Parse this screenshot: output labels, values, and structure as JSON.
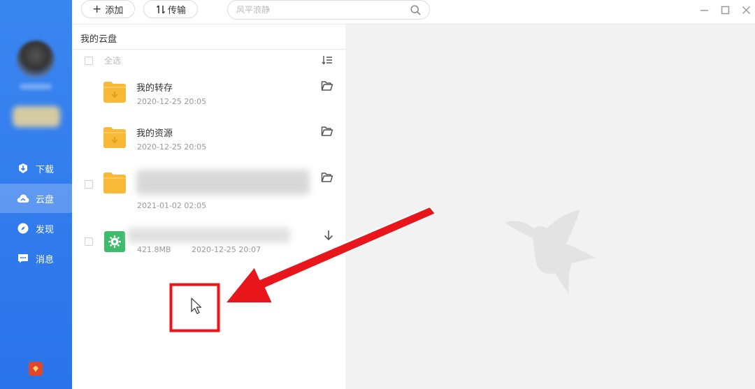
{
  "sidebar": {
    "items": [
      {
        "label": "下载",
        "icon": "download-icon"
      },
      {
        "label": "云盘",
        "icon": "cloud-icon"
      },
      {
        "label": "发现",
        "icon": "compass-icon"
      },
      {
        "label": "消息",
        "icon": "message-icon"
      }
    ],
    "active": "云盘"
  },
  "toolbar": {
    "add_label": "添加",
    "transfer_label": "传输",
    "search_placeholder": "风平浪静"
  },
  "panel": {
    "breadcrumb": "我的云盘",
    "select_all": "全选",
    "files": [
      {
        "name": "我的转存",
        "date": "2020-12-25 20:05",
        "type": "folder"
      },
      {
        "name": "我的资源",
        "date": "2020-12-25 20:05",
        "type": "folder"
      },
      {
        "name": "",
        "date": "2021-01-02 02:05",
        "type": "folder"
      },
      {
        "name": "",
        "size": "421.8MB",
        "date": "2020-12-25 20:07",
        "type": "file"
      }
    ]
  },
  "colors": {
    "sidebar": "#2f7bef",
    "folder": "#f8b938",
    "annotation_red": "#e8151b"
  }
}
